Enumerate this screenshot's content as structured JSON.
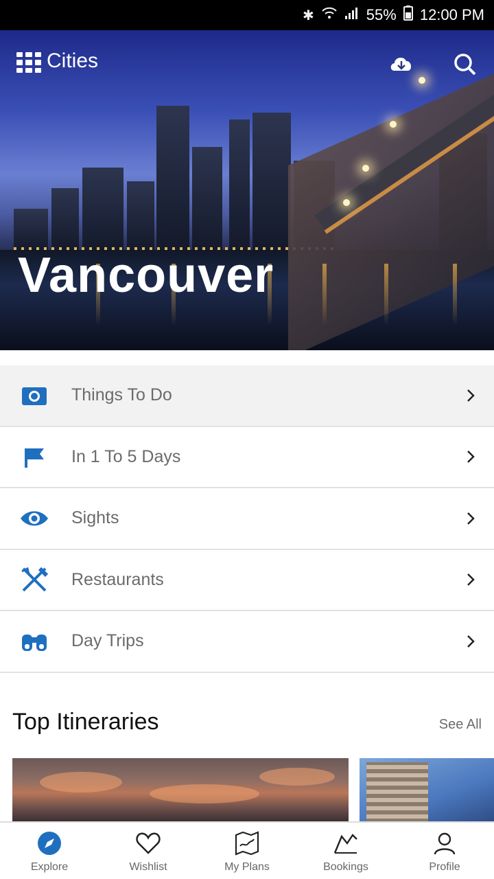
{
  "status_bar": {
    "battery": "55%",
    "time": "12:00 PM",
    "icons": [
      "bluetooth-icon",
      "wifi-icon",
      "signal-icon",
      "battery-icon"
    ]
  },
  "hero": {
    "menu_label": "Cities",
    "city_name": "Vancouver",
    "actions": [
      "download-cloud-icon",
      "search-icon"
    ]
  },
  "menu": {
    "items": [
      {
        "label": "Things To Do",
        "icon": "camera-icon",
        "icon_color": "#1f6fbf"
      },
      {
        "label": "In 1 To 5 Days",
        "icon": "flag-icon",
        "icon_color": "#1f6fbf"
      },
      {
        "label": "Sights",
        "icon": "eye-icon",
        "icon_color": "#1f6fbf"
      },
      {
        "label": "Restaurants",
        "icon": "fork-knife-icon",
        "icon_color": "#1f6fbf"
      },
      {
        "label": "Day Trips",
        "icon": "binoculars-icon",
        "icon_color": "#1f6fbf"
      }
    ]
  },
  "itineraries": {
    "title": "Top Itineraries",
    "see_all": "See All"
  },
  "bottom_nav": {
    "items": [
      {
        "label": "Explore",
        "icon": "compass-icon"
      },
      {
        "label": "Wishlist",
        "icon": "heart-icon"
      },
      {
        "label": "My Plans",
        "icon": "map-icon"
      },
      {
        "label": "Bookings",
        "icon": "ticket-icon"
      },
      {
        "label": "Profile",
        "icon": "user-icon"
      }
    ]
  },
  "colors": {
    "accent": "#1f6fbf",
    "text_muted": "#6b6b6b"
  }
}
